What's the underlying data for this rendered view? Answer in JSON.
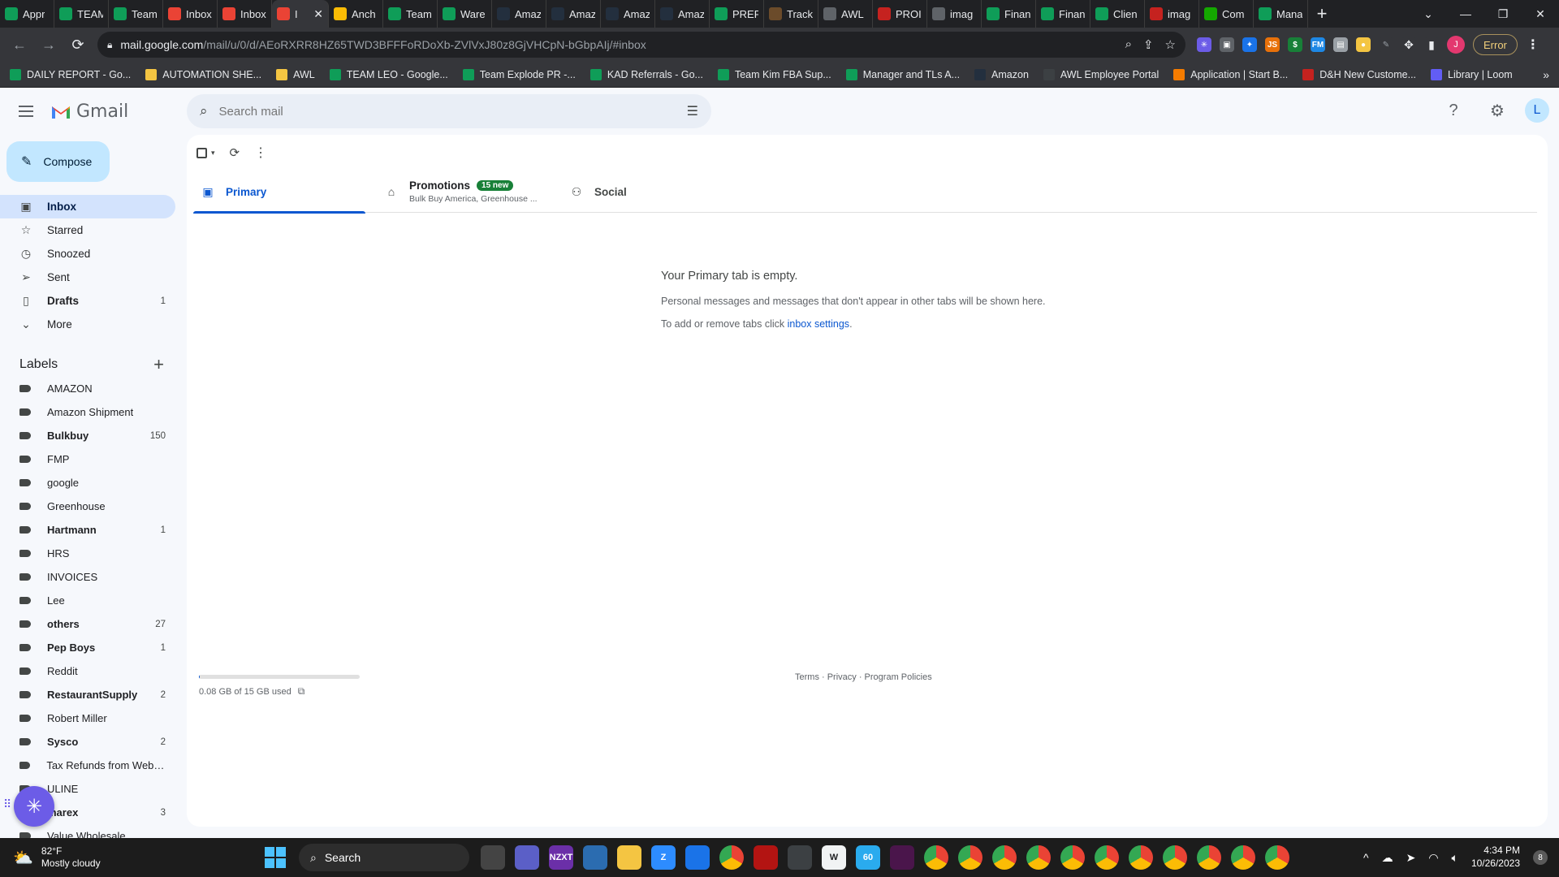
{
  "browser": {
    "tabs": [
      {
        "label": "Appr",
        "icon": "sheets-icon",
        "color": "#0f9d58"
      },
      {
        "label": "TEAM",
        "icon": "sheets-icon",
        "color": "#0f9d58"
      },
      {
        "label": "Team",
        "icon": "sheets-icon",
        "color": "#0f9d58"
      },
      {
        "label": "Inbox",
        "icon": "gmail-icon",
        "color": "#ea4335"
      },
      {
        "label": "Inbox",
        "icon": "gmail-icon",
        "color": "#ea4335"
      },
      {
        "label": "I",
        "icon": "gmail-icon",
        "color": "#ea4335",
        "active": true
      },
      {
        "label": "Anch",
        "icon": "drive-icon",
        "color": "#fbbc05"
      },
      {
        "label": "Team",
        "icon": "sheets-icon",
        "color": "#0f9d58"
      },
      {
        "label": "Ware",
        "icon": "sheets-icon",
        "color": "#0f9d58"
      },
      {
        "label": "Amaz",
        "icon": "amazon-icon",
        "color": "#232f3e"
      },
      {
        "label": "Amaz",
        "icon": "amazon-icon",
        "color": "#232f3e"
      },
      {
        "label": "Amaz",
        "icon": "amazon-icon",
        "color": "#232f3e"
      },
      {
        "label": "Amaz",
        "icon": "amazon-icon",
        "color": "#232f3e"
      },
      {
        "label": "PREP",
        "icon": "sheets-icon",
        "color": "#0f9d58"
      },
      {
        "label": "Track",
        "icon": "ups-icon",
        "color": "#6b4b2a"
      },
      {
        "label": "AWL",
        "icon": "globe-icon",
        "color": "#5f6368"
      },
      {
        "label": "PROI",
        "icon": "check-icon",
        "color": "#c5221f"
      },
      {
        "label": "imag",
        "icon": "globe-icon",
        "color": "#5f6368"
      },
      {
        "label": "Finan",
        "icon": "sheets-icon",
        "color": "#0f9d58"
      },
      {
        "label": "Finan",
        "icon": "sheets-icon",
        "color": "#0f9d58"
      },
      {
        "label": "Clien",
        "icon": "sheets-icon",
        "color": "#0f9d58"
      },
      {
        "label": "imag",
        "icon": "triangle-icon",
        "color": "#c5221f"
      },
      {
        "label": "Com",
        "icon": "upwork-icon",
        "color": "#14a800"
      },
      {
        "label": "Mana",
        "icon": "sheets-icon",
        "color": "#0f9d58"
      }
    ],
    "url_host": "mail.google.com",
    "url_path": "/mail/u/0/d/AEoRXRR8HZ65TWD3BFFFoRDoXb-ZVlVxJ80z8GjVHCpN-bGbpAIj/#inbox",
    "profile_initial": "J",
    "error_label": "Error",
    "bookmarks": [
      {
        "label": "DAILY REPORT - Go...",
        "icon": "sheets-icon",
        "color": "#0f9d58"
      },
      {
        "label": "AUTOMATION SHE...",
        "icon": "folder-icon",
        "color": "#f4c542"
      },
      {
        "label": "AWL",
        "icon": "folder-icon",
        "color": "#f4c542"
      },
      {
        "label": "TEAM LEO - Google...",
        "icon": "sheets-icon",
        "color": "#0f9d58"
      },
      {
        "label": "Team Explode PR -...",
        "icon": "sheets-icon",
        "color": "#0f9d58"
      },
      {
        "label": "KAD Referrals - Go...",
        "icon": "sheets-icon",
        "color": "#0f9d58"
      },
      {
        "label": "Team Kim FBA Sup...",
        "icon": "sheets-icon",
        "color": "#0f9d58"
      },
      {
        "label": "Manager and TLs A...",
        "icon": "sheets-icon",
        "color": "#0f9d58"
      },
      {
        "label": "Amazon",
        "icon": "amazon-icon",
        "color": "#232f3e"
      },
      {
        "label": "AWL Employee Portal",
        "icon": "globe-icon",
        "color": "#3c4043"
      },
      {
        "label": "Application | Start B...",
        "icon": "app-icon",
        "color": "#f57c00"
      },
      {
        "label": "D&H New Custome...",
        "icon": "dh-icon",
        "color": "#c5221f"
      },
      {
        "label": "Library | Loom",
        "icon": "loom-icon",
        "color": "#625df5"
      }
    ]
  },
  "gmail": {
    "product_name": "Gmail",
    "search_placeholder": "Search mail",
    "compose_label": "Compose",
    "avatar_initial": "L",
    "nav": [
      {
        "label": "Inbox",
        "icon": "inbox-icon",
        "count": "",
        "selected": true,
        "bold": true
      },
      {
        "label": "Starred",
        "icon": "star-icon",
        "count": ""
      },
      {
        "label": "Snoozed",
        "icon": "clock-icon",
        "count": ""
      },
      {
        "label": "Sent",
        "icon": "send-icon",
        "count": ""
      },
      {
        "label": "Drafts",
        "icon": "draft-icon",
        "count": "1",
        "bold": true
      },
      {
        "label": "More",
        "icon": "chevron-down-icon",
        "count": ""
      }
    ],
    "labels_heading": "Labels",
    "labels": [
      {
        "name": "AMAZON",
        "count": ""
      },
      {
        "name": "Amazon Shipment",
        "count": ""
      },
      {
        "name": "Bulkbuy",
        "count": "150",
        "bold": true
      },
      {
        "name": "FMP",
        "count": ""
      },
      {
        "name": "google",
        "count": ""
      },
      {
        "name": "Greenhouse",
        "count": ""
      },
      {
        "name": "Hartmann",
        "count": "1",
        "bold": true
      },
      {
        "name": "HRS",
        "count": ""
      },
      {
        "name": "INVOICES",
        "count": ""
      },
      {
        "name": "Lee",
        "count": ""
      },
      {
        "name": "others",
        "count": "27",
        "bold": true
      },
      {
        "name": "Pep Boys",
        "count": "1",
        "bold": true
      },
      {
        "name": "Reddit",
        "count": ""
      },
      {
        "name": "RestaurantSupply",
        "count": "2",
        "bold": true
      },
      {
        "name": "Robert Miller",
        "count": ""
      },
      {
        "name": "Sysco",
        "count": "2",
        "bold": true
      },
      {
        "name": "Tax Refunds from Webst...",
        "count": ""
      },
      {
        "name": "ULINE",
        "count": ""
      },
      {
        "name": "marex",
        "count": "3",
        "bold": true
      },
      {
        "name": "Value Wholesale",
        "count": ""
      }
    ],
    "inbox_tabs": {
      "primary": "Primary",
      "promotions": "Promotions",
      "promotions_badge": "15 new",
      "promotions_senders": "Bulk Buy America, Greenhouse ...",
      "social": "Social"
    },
    "empty_state": {
      "title": "Your Primary tab is empty.",
      "line1": "Personal messages and messages that don't appear in other tabs will be shown here.",
      "line2_prefix": "To add or remove tabs click ",
      "line2_link": "inbox settings",
      "line2_suffix": "."
    },
    "storage": {
      "text": "0.08 GB of 15 GB used",
      "fraction_used": 0.005
    },
    "footer": "Terms · Privacy · Program Policies"
  },
  "taskbar": {
    "temperature": "82°F",
    "condition": "Mostly cloudy",
    "search_label": "Search",
    "time": "4:34 PM",
    "date": "10/26/2023",
    "notification_count": "8",
    "apps": [
      {
        "icon": "task-view-icon",
        "color": "#444"
      },
      {
        "icon": "teams-icon",
        "color": "#5b5fc7"
      },
      {
        "icon": "nzxt-icon",
        "color": "#6b2fa8",
        "text": "NZXT"
      },
      {
        "icon": "capture-icon",
        "color": "#2b6cb0"
      },
      {
        "icon": "explorer-icon",
        "color": "#f4c542"
      },
      {
        "icon": "zoom-icon",
        "color": "#2d8cff",
        "text": "Z"
      },
      {
        "icon": "calendar-icon",
        "color": "#1a73e8"
      },
      {
        "icon": "chrome-icon",
        "color": "chrome"
      },
      {
        "icon": "app-red-icon",
        "color": "#b31412"
      },
      {
        "icon": "calculator-icon",
        "color": "#3c4043"
      },
      {
        "icon": "wave-icon",
        "color": "#f1f3f4",
        "text": "W"
      },
      {
        "icon": "telegram-icon",
        "color": "#2aabee",
        "text": "60"
      },
      {
        "icon": "slack-icon",
        "color": "#4a154b"
      },
      {
        "icon": "chrome-icon",
        "color": "chrome"
      },
      {
        "icon": "chrome-icon",
        "color": "chrome"
      },
      {
        "icon": "chrome-icon",
        "color": "chrome"
      },
      {
        "icon": "chrome-icon",
        "color": "chrome"
      },
      {
        "icon": "chrome-icon",
        "color": "chrome"
      },
      {
        "icon": "chrome-icon",
        "color": "chrome"
      },
      {
        "icon": "chrome-icon",
        "color": "chrome"
      },
      {
        "icon": "chrome-icon",
        "color": "chrome"
      },
      {
        "icon": "chrome-icon",
        "color": "chrome"
      },
      {
        "icon": "chrome-icon",
        "color": "chrome"
      },
      {
        "icon": "chrome-icon",
        "color": "chrome"
      }
    ]
  }
}
